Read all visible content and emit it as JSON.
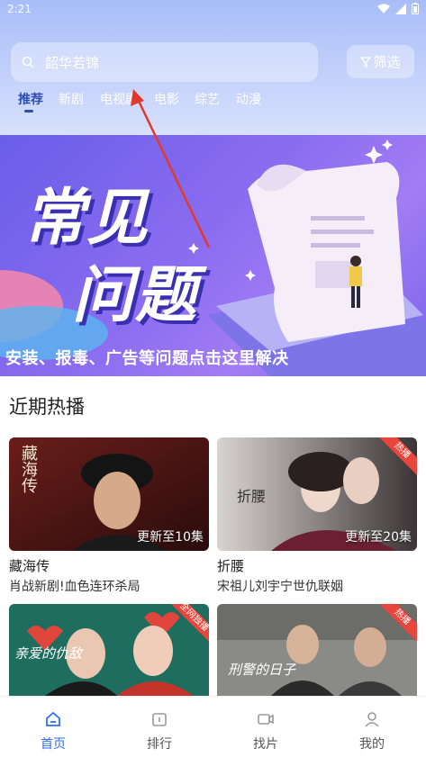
{
  "status_bar": {
    "time": "2:21"
  },
  "search": {
    "query": "韶华若锦",
    "filter_label": "筛选"
  },
  "tabs": [
    {
      "label": "推荐",
      "active": true
    },
    {
      "label": "新剧",
      "active": false
    },
    {
      "label": "电视剧",
      "active": false
    },
    {
      "label": "电影",
      "active": false
    },
    {
      "label": "综艺",
      "active": false
    },
    {
      "label": "动漫",
      "active": false
    }
  ],
  "banner": {
    "headline_line1": "常见",
    "headline_line2": "问题",
    "caption": "安装、报毒、广告等问题点击这里解决"
  },
  "section": {
    "title": "近期热播"
  },
  "cards": [
    {
      "title": "藏海传",
      "desc": "肖战新剧!血色连环杀局",
      "update": "更新至10集",
      "poster_text": "藏海传"
    },
    {
      "title": "折腰",
      "desc": "宋祖儿刘宇宁世仇联姻",
      "update": "更新至20集",
      "badge": "热播",
      "poster_text": "折腰"
    },
    {
      "poster_text": "亲爱的仇敌",
      "badge": "全网独播"
    },
    {
      "poster_text": "刑警的日子",
      "badge": "热播"
    }
  ],
  "bottom_nav": [
    {
      "label": "首页",
      "icon": "home-icon",
      "active": true
    },
    {
      "label": "排行",
      "icon": "ranking-icon",
      "active": false
    },
    {
      "label": "找片",
      "icon": "film-icon",
      "active": false
    },
    {
      "label": "我的",
      "icon": "user-icon",
      "active": false
    }
  ],
  "colors": {
    "accent": "#2e6ef0",
    "badge": "#e8453c",
    "header_bg": "#a8bdf8"
  }
}
